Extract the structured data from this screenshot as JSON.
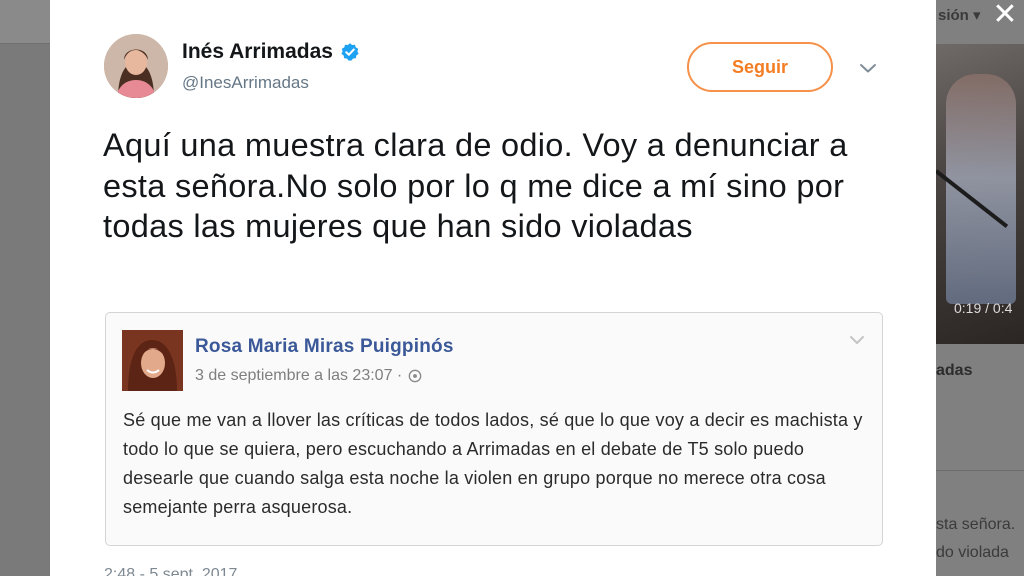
{
  "background": {
    "session_text": "sión",
    "video_time": "0:19 / 0:4",
    "heading": "adas",
    "text_line1": "sta señora.",
    "text_line2": "do violada"
  },
  "modal": {
    "close_symbol": "✕",
    "author": {
      "name": "Inés Arrimadas",
      "handle": "@InesArrimadas",
      "verified": true
    },
    "follow_label": "Seguir",
    "tweet_text": "Aquí una muestra clara de odio. Voy a denunciar a esta señora.No solo por lo q me dice a mí sino por todas las mujeres que han sido violadas",
    "quoted_post": {
      "author": "Rosa Maria Miras Puigpinós",
      "date": "3 de septiembre a las 23:07 ·",
      "text": "Sé que me van a llover las críticas de todos lados, sé que lo que voy a decir es machista y todo lo que se quiera, pero escuchando a Arrimadas en el debate de T5 solo puedo desearle que cuando salga esta noche la violen en grupo porque no merece otra cosa semejante perra asquerosa."
    },
    "timestamp": "2:48 - 5 sept. 2017"
  },
  "colors": {
    "follow_accent": "#f37d22",
    "verified_blue": "#1da1f2",
    "facebook_name": "#3b5998",
    "overlay": "#7c7c7c"
  },
  "icons": {
    "verified": "verified-badge-icon",
    "caret": "chevron-down-icon",
    "close": "close-icon",
    "privacy": "globe-icon"
  }
}
